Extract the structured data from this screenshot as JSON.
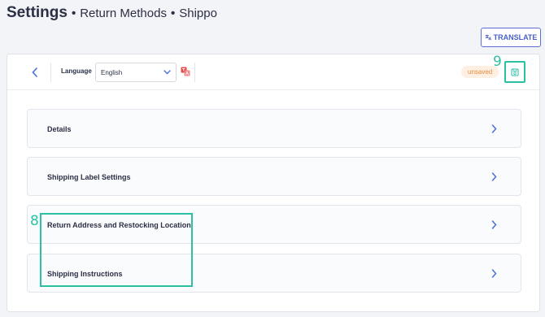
{
  "header": {
    "title": "Settings",
    "separator": "•",
    "breadcrumb": [
      "Return Methods",
      "Shippo"
    ]
  },
  "translate_button": {
    "label": "TRANSLATE"
  },
  "toolbar": {
    "language_label": "Language",
    "language_value": "English",
    "status_badge": "unsaved"
  },
  "sections": [
    {
      "label": "Details"
    },
    {
      "label": "Shipping Label Settings"
    },
    {
      "label": "Return Address and Restocking Location"
    },
    {
      "label": "Shipping Instructions"
    }
  ],
  "callouts": {
    "sections": "8",
    "save": "9"
  },
  "colors": {
    "accent": "#4a5fc7",
    "callout": "#2bbfa4",
    "unsaved_text": "#e98b3e",
    "unsaved_bg": "#fdf0e3",
    "chevron": "#4a6fd6"
  },
  "icons": [
    "translate-icon",
    "back-arrow-icon",
    "chevron-down-icon",
    "language-toggle-icon",
    "save-icon",
    "chevron-right-icon"
  ]
}
